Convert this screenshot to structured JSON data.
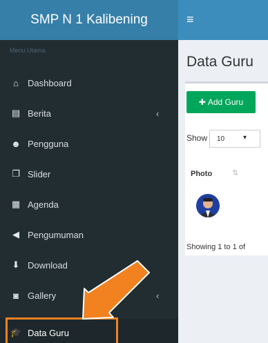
{
  "app": {
    "title": "SMP N 1 Kalibening",
    "menu_icon": "bars-icon"
  },
  "sidebar": {
    "header": "Menu Utama",
    "items": [
      {
        "label": "Dashboard",
        "icon": "home-icon",
        "glyph": "⌂",
        "has_submenu": false
      },
      {
        "label": "Berita",
        "icon": "newspaper-icon",
        "glyph": "▤",
        "has_submenu": true
      },
      {
        "label": "Pengguna",
        "icon": "users-icon",
        "glyph": "☻",
        "has_submenu": false
      },
      {
        "label": "Slider",
        "icon": "clone-icon",
        "glyph": "❐",
        "has_submenu": false
      },
      {
        "label": "Agenda",
        "icon": "calendar-icon",
        "glyph": "▦",
        "has_submenu": false
      },
      {
        "label": "Pengumuman",
        "icon": "volume-icon",
        "glyph": "◀",
        "has_submenu": false
      },
      {
        "label": "Download",
        "icon": "download-icon",
        "glyph": "⬇",
        "has_submenu": false
      },
      {
        "label": "Gallery",
        "icon": "camera-icon",
        "glyph": "◙",
        "has_submenu": true
      },
      {
        "label": "Data Guru",
        "icon": "graduation-cap-icon",
        "glyph": "🎓",
        "has_submenu": false,
        "active": true
      }
    ],
    "submenu_glyph": "‹"
  },
  "content": {
    "title": "Data Guru",
    "add_button": {
      "icon_glyph": "✚",
      "label": "Add Guru"
    },
    "length": {
      "show_label": "Show",
      "value": "10",
      "chevron": "▾"
    },
    "table": {
      "columns": [
        "Photo"
      ],
      "sort_glyph": "⇅"
    },
    "info_text": "Showing 1 to 1 of"
  },
  "colors": {
    "topbar": "#3c8dbc",
    "logo": "#367fa9",
    "sidebar": "#222d32",
    "add_button": "#00a65a",
    "highlight": "#f28220"
  }
}
